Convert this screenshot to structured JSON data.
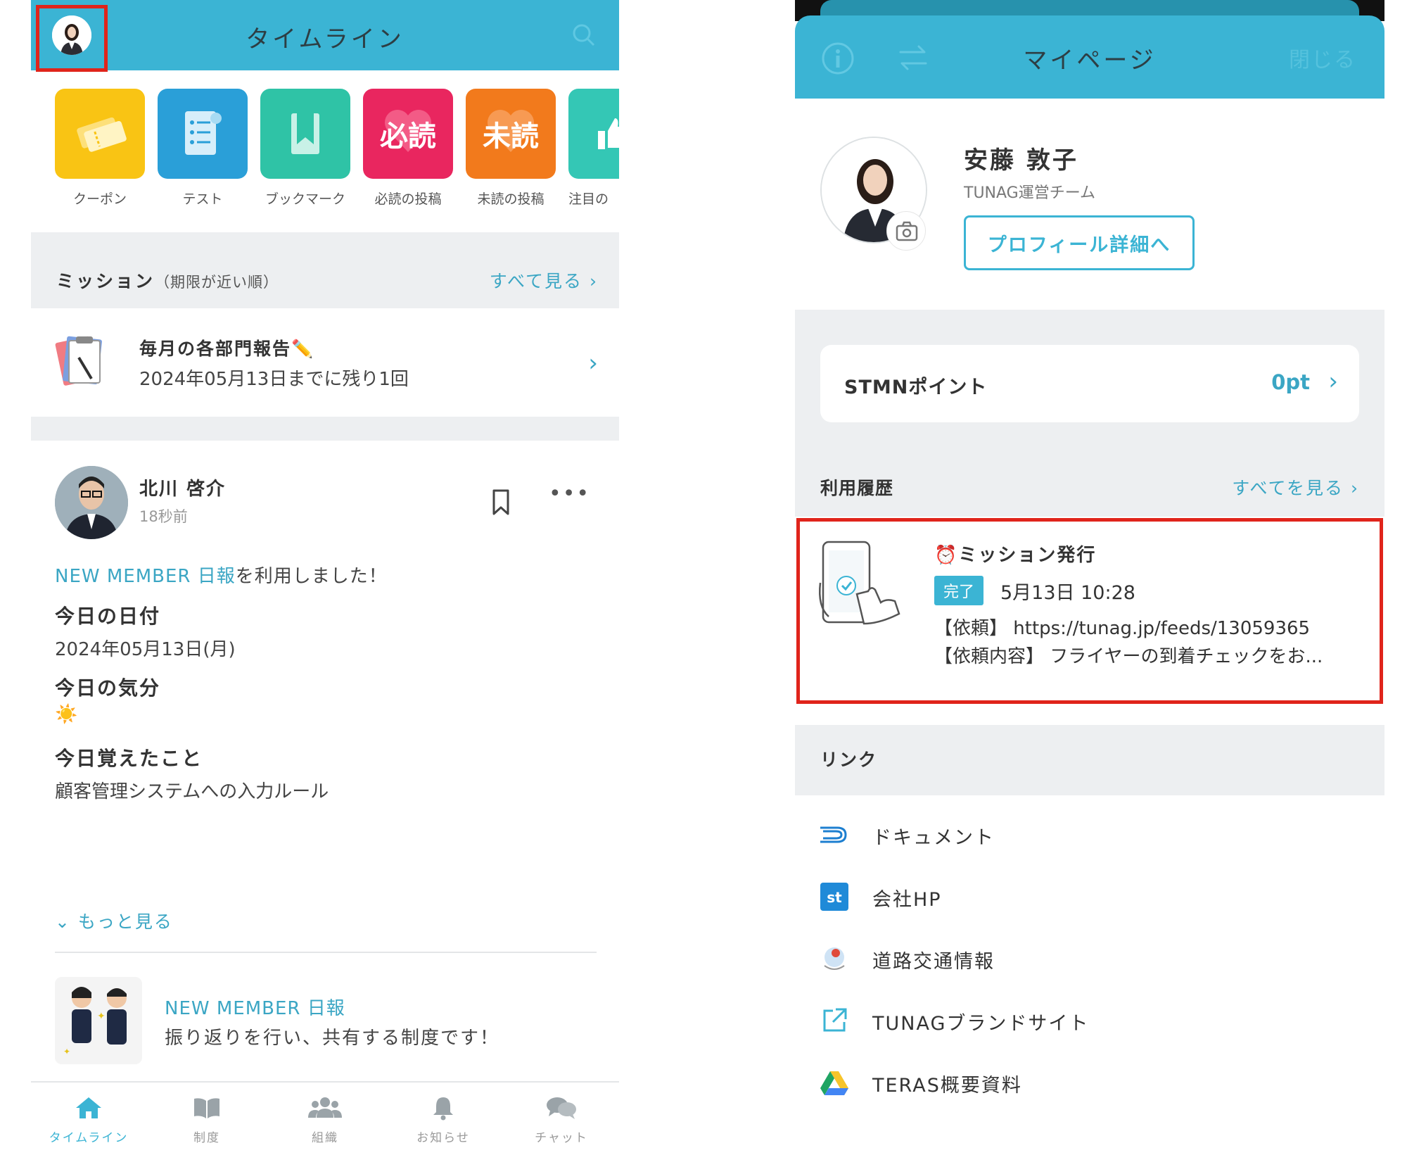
{
  "timeline": {
    "header": {
      "title": "タイムライン"
    },
    "shortcuts": [
      {
        "label": "クーポン",
        "icon": "coupon-icon",
        "color": "#f9c414"
      },
      {
        "label": "テスト",
        "icon": "test-icon",
        "color": "#2a9fd8"
      },
      {
        "label": "ブックマーク",
        "icon": "bookmark-icon",
        "color": "#2fc3a6"
      },
      {
        "label": "必読の投稿",
        "icon": "must-read-icon",
        "big": "必読",
        "color": "#e9265f"
      },
      {
        "label": "未読の投稿",
        "icon": "unread-icon",
        "big": "未読",
        "color": "#f27a1c"
      },
      {
        "label": "注目の",
        "icon": "thumb-up-icon",
        "color": "#34c7b5"
      }
    ],
    "mission": {
      "title": "ミッション",
      "subtitle": "（期限が近い順）",
      "see_all": "すべて見る",
      "item": {
        "title": "毎月の各部門報告✏️",
        "deadline": "2024年05月13日までに残り1回"
      }
    },
    "post": {
      "author": "北川 啓介",
      "time": "18秒前",
      "system_link": "NEW MEMBER 日報",
      "used_text": "を利用しました！",
      "fields": [
        {
          "label": "今日の日付",
          "value": "2024年05月13日(月)"
        },
        {
          "label": "今日の気分",
          "value": "☀️"
        },
        {
          "label": "今日覚えたこと",
          "value": "顧客管理システムへの入力ルール"
        }
      ],
      "more": "もっと見る",
      "system": {
        "name": "NEW MEMBER 日報",
        "description": "振り返りを行い、共有する制度です！"
      }
    },
    "tabs": [
      {
        "label": "タイムライン",
        "icon": "home-icon",
        "active": true
      },
      {
        "label": "制度",
        "icon": "book-icon",
        "active": false
      },
      {
        "label": "組織",
        "icon": "people-icon",
        "active": false
      },
      {
        "label": "お知らせ",
        "icon": "bell-icon",
        "active": false
      },
      {
        "label": "チャット",
        "icon": "chat-icon",
        "active": false
      }
    ]
  },
  "mypage": {
    "header": {
      "title": "マイページ",
      "close": "閉じる"
    },
    "profile": {
      "name": "安藤 敦子",
      "team": "TUNAG運営チーム",
      "button": "プロフィール詳細へ"
    },
    "points": {
      "label": "STMNポイント",
      "value": "0pt"
    },
    "history": {
      "label": "利用履歴",
      "see_all": "すべてを見る",
      "item": {
        "title": "⏰ミッション発行",
        "badge": "完了",
        "datetime": "5月13日 10:28",
        "request": "【依頼】 https://tunag.jp/feeds/13059365",
        "request_detail": "【依頼内容】 フライヤーの到着チェックをお..."
      }
    },
    "links": {
      "label": "リンク",
      "items": [
        {
          "label": "ドキュメント",
          "icon": "document-logo-icon"
        },
        {
          "label": "会社HP",
          "icon": "st-logo-icon"
        },
        {
          "label": "道路交通情報",
          "icon": "road-logo-icon"
        },
        {
          "label": "TUNAGブランドサイト",
          "icon": "external-link-icon"
        },
        {
          "label": "TERAS概要資料",
          "icon": "drive-logo-icon"
        }
      ]
    }
  },
  "colors": {
    "accent": "#3bb4d4",
    "link": "#3ba6c4",
    "highlight": "#e0241b"
  }
}
